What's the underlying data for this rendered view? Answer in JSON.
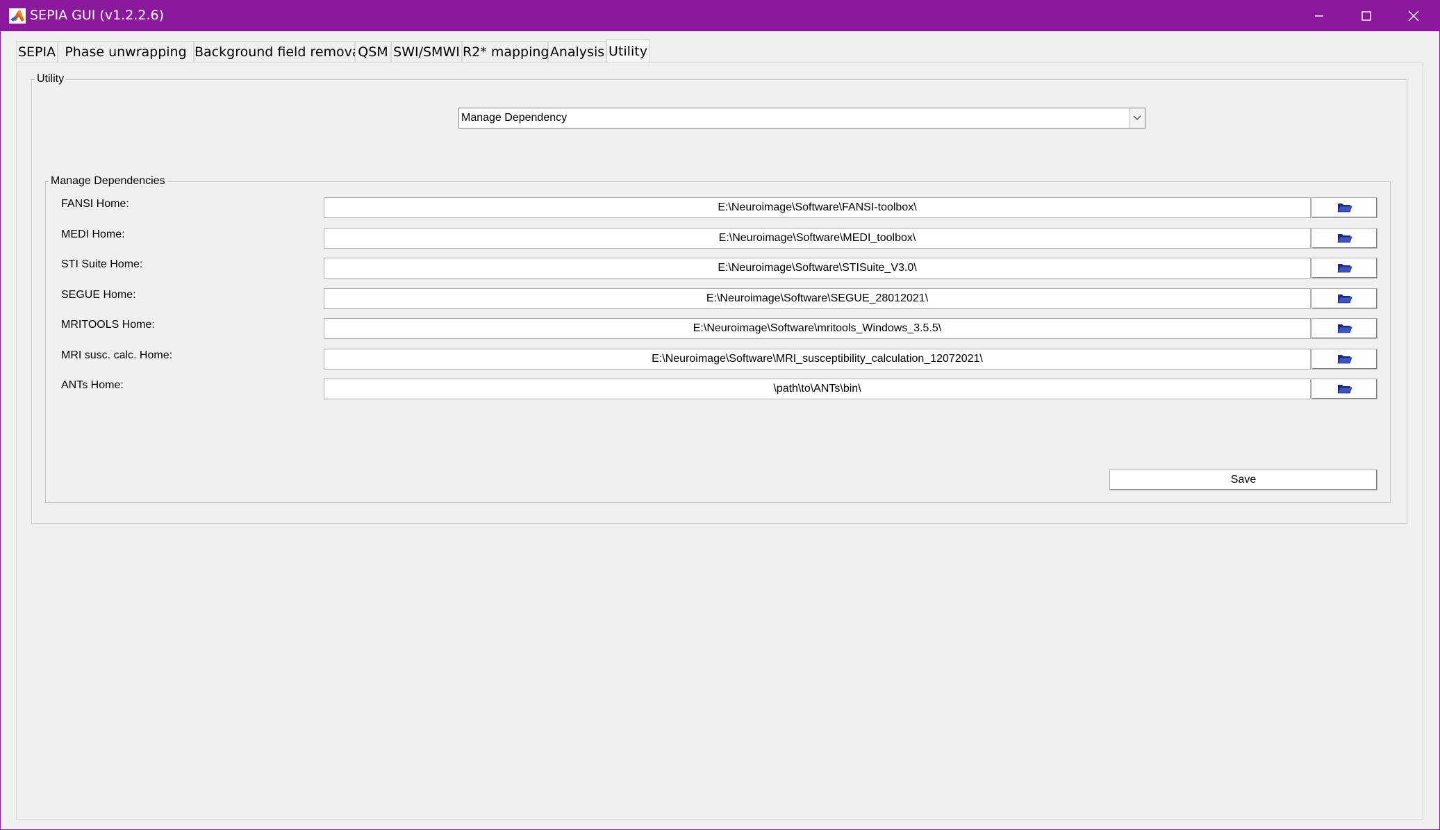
{
  "window": {
    "title": "SEPIA GUI (v1.2.2.6)",
    "accent_color": "#8a1a9b"
  },
  "tabs": [
    {
      "label": "SEPIA",
      "active": false
    },
    {
      "label": "Phase unwrapping",
      "active": false
    },
    {
      "label": "Background field removal",
      "active": false
    },
    {
      "label": "QSM",
      "active": false
    },
    {
      "label": "SWI/SMWI",
      "active": false
    },
    {
      "label": "R2* mapping",
      "active": false
    },
    {
      "label": "Analysis",
      "active": false
    },
    {
      "label": "Utility",
      "active": true
    }
  ],
  "utility": {
    "group_title": "Utility",
    "selected_tool": "Manage Dependency"
  },
  "dependencies": {
    "group_title": "Manage Dependencies",
    "rows": [
      {
        "label": "FANSI Home:",
        "path": "E:\\Neuroimage\\Software\\FANSI-toolbox\\"
      },
      {
        "label": "MEDI Home:",
        "path": "E:\\Neuroimage\\Software\\MEDI_toolbox\\"
      },
      {
        "label": "STI Suite Home:",
        "path": "E:\\Neuroimage\\Software\\STISuite_V3.0\\"
      },
      {
        "label": "SEGUE Home:",
        "path": "E:\\Neuroimage\\Software\\SEGUE_28012021\\"
      },
      {
        "label": "MRITOOLS Home:",
        "path": "E:\\Neuroimage\\Software\\mritools_Windows_3.5.5\\"
      },
      {
        "label": "MRI susc. calc. Home:",
        "path": "E:\\Neuroimage\\Software\\MRI_susceptibility_calculation_12072021\\"
      },
      {
        "label": "ANTs Home:",
        "path": "\\path\\to\\ANTs\\bin\\"
      }
    ],
    "browse_icon": "folder-open-icon",
    "save_label": "Save"
  }
}
